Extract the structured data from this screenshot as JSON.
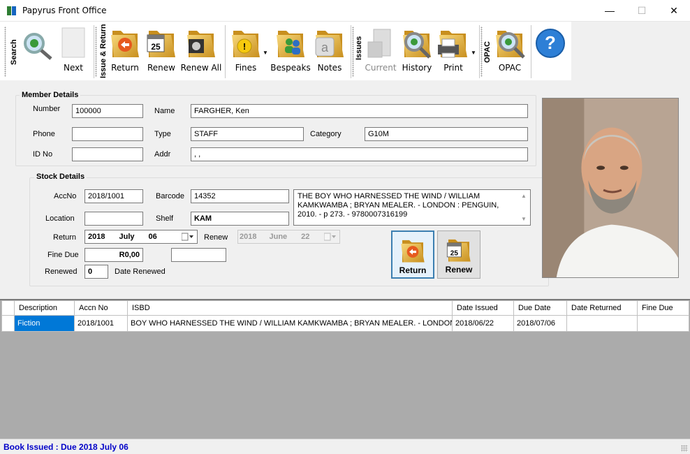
{
  "window": {
    "title": "Papyrus Front Office"
  },
  "toolbar": {
    "groups": {
      "search": "Search",
      "issue_return": "Issue & Return",
      "issues": "Issues",
      "opac": "OPAC"
    },
    "buttons": {
      "next": "Next",
      "return": "Return",
      "renew": "Renew",
      "renew_all": "Renew All",
      "fines": "Fines",
      "bespeaks": "Bespeaks",
      "notes": "Notes",
      "current": "Current",
      "history": "History",
      "print": "Print",
      "opac": "OPAC"
    },
    "calendar_day": "25"
  },
  "member": {
    "title": "Member Details",
    "labels": {
      "number": "Number",
      "name": "Name",
      "phone": "Phone",
      "type": "Type",
      "category": "Category",
      "id_no": "ID No",
      "addr": "Addr"
    },
    "values": {
      "number": "100000",
      "name": "FARGHER, Ken",
      "phone": "",
      "type": "STAFF",
      "category": "G10M",
      "id_no": "",
      "addr": ", ,"
    }
  },
  "stock": {
    "title": "Stock Details",
    "labels": {
      "accno": "AccNo",
      "barcode": "Barcode",
      "location": "Location",
      "shelf": "Shelf",
      "return": "Return",
      "renew": "Renew",
      "fine_due": "Fine Due",
      "renewed": "Renewed",
      "date_renewed": "Date Renewed"
    },
    "values": {
      "accno": "2018/1001",
      "barcode": "14352",
      "location": "",
      "shelf": "KAM",
      "isbd": "THE BOY WHO HARNESSED THE WIND / WILLIAM KAMKWAMBA ; BRYAN MEALER. - LONDON : PENGUIN, 2010. - p 273. - 9780007316199",
      "return_date": {
        "year": "2018",
        "month": "July",
        "day": "06"
      },
      "renew_date": {
        "year": "2018",
        "month": "June",
        "day": "22"
      },
      "fine_due": "R0,00",
      "fine_extra": "",
      "renewed": "0"
    },
    "actions": {
      "return": "Return",
      "renew": "Renew"
    }
  },
  "loans": {
    "columns": [
      "Description",
      "Accn No",
      "ISBD",
      "Date Issued",
      "Due Date",
      "Date Returned",
      "Fine Due"
    ],
    "rows": [
      {
        "description": "Fiction",
        "accn_no": "2018/1001",
        "isbd": "BOY WHO HARNESSED THE WIND / WILLIAM KAMKWAMBA ; BRYAN MEALER. - LONDON : ...",
        "date_issued": "2018/06/22",
        "due_date": "2018/07/06",
        "date_returned": "",
        "fine_due": ""
      }
    ]
  },
  "status": {
    "message": "Book Issued : Due 2018 July 06"
  },
  "colors": {
    "accent": "#0078d7",
    "status_text": "#0000c8",
    "folder": "#e8b84a"
  }
}
